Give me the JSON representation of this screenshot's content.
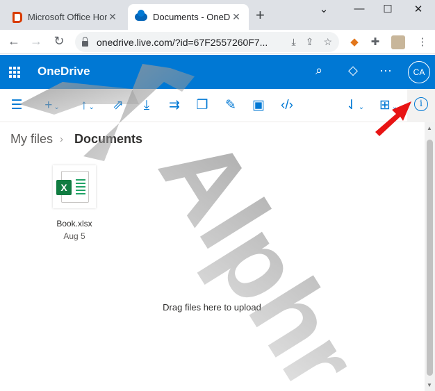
{
  "browser": {
    "tabs": [
      {
        "title": "Microsoft Office Hom",
        "favicon": "office-icon",
        "active": false
      },
      {
        "title": "Documents - OneDr",
        "favicon": "onedrive-icon",
        "active": true
      }
    ],
    "new_tab_glyph": "+",
    "window_controls": {
      "minimize": "—",
      "maximize": "☐",
      "close": "✕",
      "tab_list": "⌄"
    },
    "url": "onedrive.live.com/?id=67F2557260F7...",
    "extensions": [
      "download-icon",
      "share-icon",
      "star-icon",
      "metamask-icon",
      "puzzle-icon",
      "profile-cat-icon",
      "menu-dots-icon"
    ]
  },
  "header": {
    "app_name": "OneDrive",
    "avatar_initials": "CA",
    "brand_color": "#0078d4"
  },
  "commands": [
    "hamburger-icon",
    "new-icon",
    "upload-icon",
    "share-icon",
    "download-icon",
    "move-icon",
    "copy-icon",
    "rename-icon",
    "embed-preview-icon",
    "embed-code-icon",
    "sort-icon",
    "view-icon",
    "info-icon"
  ],
  "breadcrumb": {
    "root": "My files",
    "current": "Documents"
  },
  "files": [
    {
      "name": "Book.xlsx",
      "date": "Aug 5",
      "type": "excel"
    }
  ],
  "drop_hint": "Drag files here to upload",
  "watermark_text": "Alphr"
}
